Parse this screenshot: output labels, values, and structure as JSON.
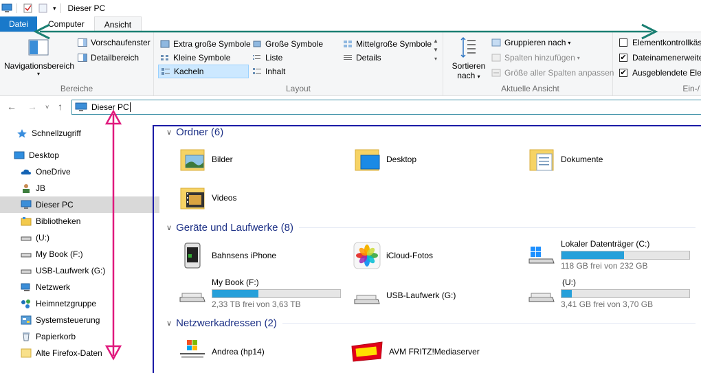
{
  "window": {
    "title": "Dieser PC"
  },
  "tabs": [
    {
      "label": "Datei"
    },
    {
      "label": "Computer"
    },
    {
      "label": "Ansicht"
    }
  ],
  "ribbon": {
    "bereiche": {
      "label": "Bereiche",
      "nav_pane": "Navigationsbereich",
      "preview": "Vorschaufenster",
      "details": "Detailbereich"
    },
    "layout": {
      "label": "Layout",
      "items": [
        "Extra große Symbole",
        "Große Symbole",
        "Mittelgroße Symbole",
        "Kleine Symbole",
        "Liste",
        "Details",
        "Kacheln",
        "Inhalt"
      ]
    },
    "aktuelle_ansicht": {
      "label": "Aktuelle Ansicht",
      "sort_line1": "Sortieren",
      "sort_line2": "nach",
      "group_by": "Gruppieren nach",
      "add_columns": "Spalten hinzufügen",
      "fit_columns": "Größe aller Spalten anpassen"
    },
    "ein_ausblenden": {
      "label": "Ein-/",
      "checkboxes": [
        {
          "label": "Elementkontrollkäst",
          "checked": false
        },
        {
          "label": "Dateinamenerweite",
          "checked": true
        },
        {
          "label": "Ausgeblendete Elem",
          "checked": true
        }
      ]
    }
  },
  "address": {
    "path": "Dieser PC"
  },
  "nav_pane": {
    "items": [
      {
        "label": "Schnellzugriff"
      },
      {
        "label": "Desktop"
      },
      {
        "label": "OneDrive"
      },
      {
        "label": "JB"
      },
      {
        "label": "Dieser PC",
        "selected": true
      },
      {
        "label": "Bibliotheken"
      },
      {
        "label": "(U:)"
      },
      {
        "label": "My Book (F:)"
      },
      {
        "label": "USB-Laufwerk (G:)"
      },
      {
        "label": "Netzwerk"
      },
      {
        "label": "Heimnetzgruppe"
      },
      {
        "label": "Systemsteuerung"
      },
      {
        "label": "Papierkorb"
      },
      {
        "label": "Alte Firefox-Daten"
      }
    ]
  },
  "content": {
    "folders": {
      "header": "Ordner (6)",
      "items": [
        {
          "label": "Bilder"
        },
        {
          "label": "Desktop"
        },
        {
          "label": "Dokumente"
        },
        {
          "label": "Videos"
        }
      ]
    },
    "devices": {
      "header": "Geräte und Laufwerke (8)",
      "items": [
        {
          "label": "Bahnsens iPhone"
        },
        {
          "label": "iCloud-Fotos"
        },
        {
          "label": "Lokaler Datenträger (C:)",
          "free": "118 GB frei von 232 GB",
          "used_fraction": 0.49
        },
        {
          "label": "My Book (F:)",
          "free": "2,33 TB frei von 3,63 TB",
          "used_fraction": 0.36
        },
        {
          "label": "USB-Laufwerk (G:)"
        },
        {
          "label": "(U:)",
          "free": "3,41 GB frei von 3,70 GB",
          "used_fraction": 0.08
        }
      ]
    },
    "network": {
      "header": "Netzwerkadressen (2)",
      "items": [
        {
          "label": "Andrea (hp14)"
        },
        {
          "label": "AVM FRITZ!Mediaserver"
        }
      ]
    }
  },
  "colors": {
    "accent": "#1979ca",
    "bar_fill": "#26a0da",
    "annot_teal": "#1a7f72",
    "annot_magenta": "#e0197d",
    "annot_blue": "#1a1aa6"
  }
}
